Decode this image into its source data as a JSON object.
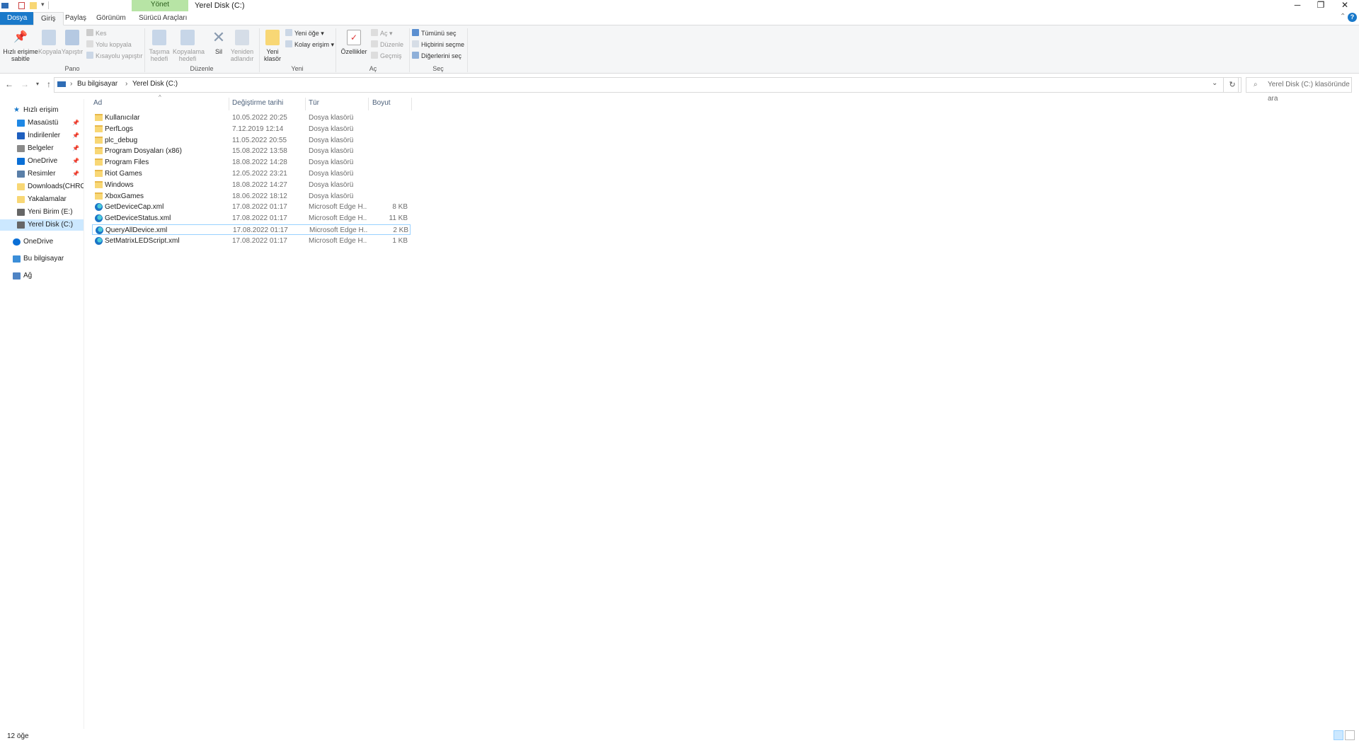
{
  "window": {
    "title": "Yerel Disk (C:)",
    "context_tab": "Yönet",
    "controls": {
      "minimize": "─",
      "restore": "❐",
      "close": "✕"
    }
  },
  "tabs": [
    "Dosya",
    "Giriş",
    "Paylaş",
    "Görünüm",
    "Sürücü Araçları"
  ],
  "ribbon": {
    "pano": {
      "label": "Pano",
      "pin": "Hızlı erişime sabitle",
      "copy": "Kopyala",
      "paste": "Yapıştır",
      "cut": "Kes",
      "copy_path": "Yolu kopyala",
      "paste_shortcut": "Kısayolu yapıştır"
    },
    "duzenle": {
      "label": "Düzenle",
      "move_to": "Taşıma hedefi",
      "copy_to": "Kopyalama hedefi",
      "delete": "Sil",
      "rename": "Yeniden adlandır"
    },
    "yeni": {
      "label": "Yeni",
      "new_folder": "Yeni klasör",
      "new_item": "Yeni öğe",
      "easy_access": "Kolay erişim"
    },
    "ac": {
      "label": "Aç",
      "properties": "Özellikler",
      "open": "Aç",
      "edit": "Düzenle",
      "history": "Geçmiş"
    },
    "sec": {
      "label": "Seç",
      "select_all": "Tümünü seç",
      "select_none": "Hiçbirini seçme",
      "invert": "Diğerlerini seç"
    }
  },
  "address": {
    "crumb1": "Bu bilgisayar",
    "crumb2": "Yerel Disk (C:)",
    "sep": "›",
    "search_placeholder": "Yerel Disk (C:) klasöründe ara"
  },
  "sidebar": {
    "quick_access": "Hızlı erişim",
    "items": [
      {
        "label": "Masaüstü",
        "icon": "desktop-icon",
        "pinned": true,
        "color": "#1e88e5"
      },
      {
        "label": "İndirilenler",
        "icon": "download-icon",
        "pinned": true,
        "color": "#1e5fbf"
      },
      {
        "label": "Belgeler",
        "icon": "document-icon",
        "pinned": true,
        "color": "#8a8a8a"
      },
      {
        "label": "OneDrive",
        "icon": "cloud-icon",
        "pinned": true,
        "color": "#0a6fd6"
      },
      {
        "label": "Resimler",
        "icon": "pictures-icon",
        "pinned": true,
        "color": "#5a7fa8"
      },
      {
        "label": "Downloads(CHROM",
        "icon": "folder-icon",
        "pinned": false,
        "color": "#f8d775"
      },
      {
        "label": "Yakalamalar",
        "icon": "folder-icon",
        "pinned": false,
        "color": "#f8d775"
      },
      {
        "label": "Yeni Birim (E:)",
        "icon": "drive-icon",
        "pinned": false,
        "color": "#666666"
      },
      {
        "label": "Yerel Disk (C:)",
        "icon": "drive-icon",
        "pinned": false,
        "color": "#666666",
        "selected": true
      }
    ],
    "onedrive": "OneDrive",
    "this_pc": "Bu bilgisayar",
    "network": "Ağ",
    "pin_glyph": "📌"
  },
  "columns": {
    "name": "Ad",
    "date": "Değiştirme tarihi",
    "type": "Tür",
    "size": "Boyut"
  },
  "files": [
    {
      "name": "Kullanıcılar",
      "date": "10.05.2022 20:25",
      "type": "Dosya klasörü",
      "size": "",
      "kind": "folder"
    },
    {
      "name": "PerfLogs",
      "date": "7.12.2019 12:14",
      "type": "Dosya klasörü",
      "size": "",
      "kind": "folder"
    },
    {
      "name": "plc_debug",
      "date": "11.05.2022 20:55",
      "type": "Dosya klasörü",
      "size": "",
      "kind": "folder"
    },
    {
      "name": "Program Dosyaları (x86)",
      "date": "15.08.2022 13:58",
      "type": "Dosya klasörü",
      "size": "",
      "kind": "folder"
    },
    {
      "name": "Program Files",
      "date": "18.08.2022 14:28",
      "type": "Dosya klasörü",
      "size": "",
      "kind": "folder"
    },
    {
      "name": "Riot Games",
      "date": "12.05.2022 23:21",
      "type": "Dosya klasörü",
      "size": "",
      "kind": "folder"
    },
    {
      "name": "Windows",
      "date": "18.08.2022 14:27",
      "type": "Dosya klasörü",
      "size": "",
      "kind": "folder"
    },
    {
      "name": "XboxGames",
      "date": "18.06.2022 18:12",
      "type": "Dosya klasörü",
      "size": "",
      "kind": "folder"
    },
    {
      "name": "GetDeviceCap.xml",
      "date": "17.08.2022 01:17",
      "type": "Microsoft Edge H...",
      "size": "8 KB",
      "kind": "edge"
    },
    {
      "name": "GetDeviceStatus.xml",
      "date": "17.08.2022 01:17",
      "type": "Microsoft Edge H...",
      "size": "11 KB",
      "kind": "edge"
    },
    {
      "name": "QueryAllDevice.xml",
      "date": "17.08.2022 01:17",
      "type": "Microsoft Edge H...",
      "size": "2 KB",
      "kind": "edge",
      "highlight": true
    },
    {
      "name": "SetMatrixLEDScript.xml",
      "date": "17.08.2022 01:17",
      "type": "Microsoft Edge H...",
      "size": "1 KB",
      "kind": "edge"
    }
  ],
  "status": {
    "count": "12 öğe"
  },
  "colors": {
    "accent": "#1979ca",
    "context_tab": "#b7e4a5",
    "selection": "#cce8ff"
  }
}
